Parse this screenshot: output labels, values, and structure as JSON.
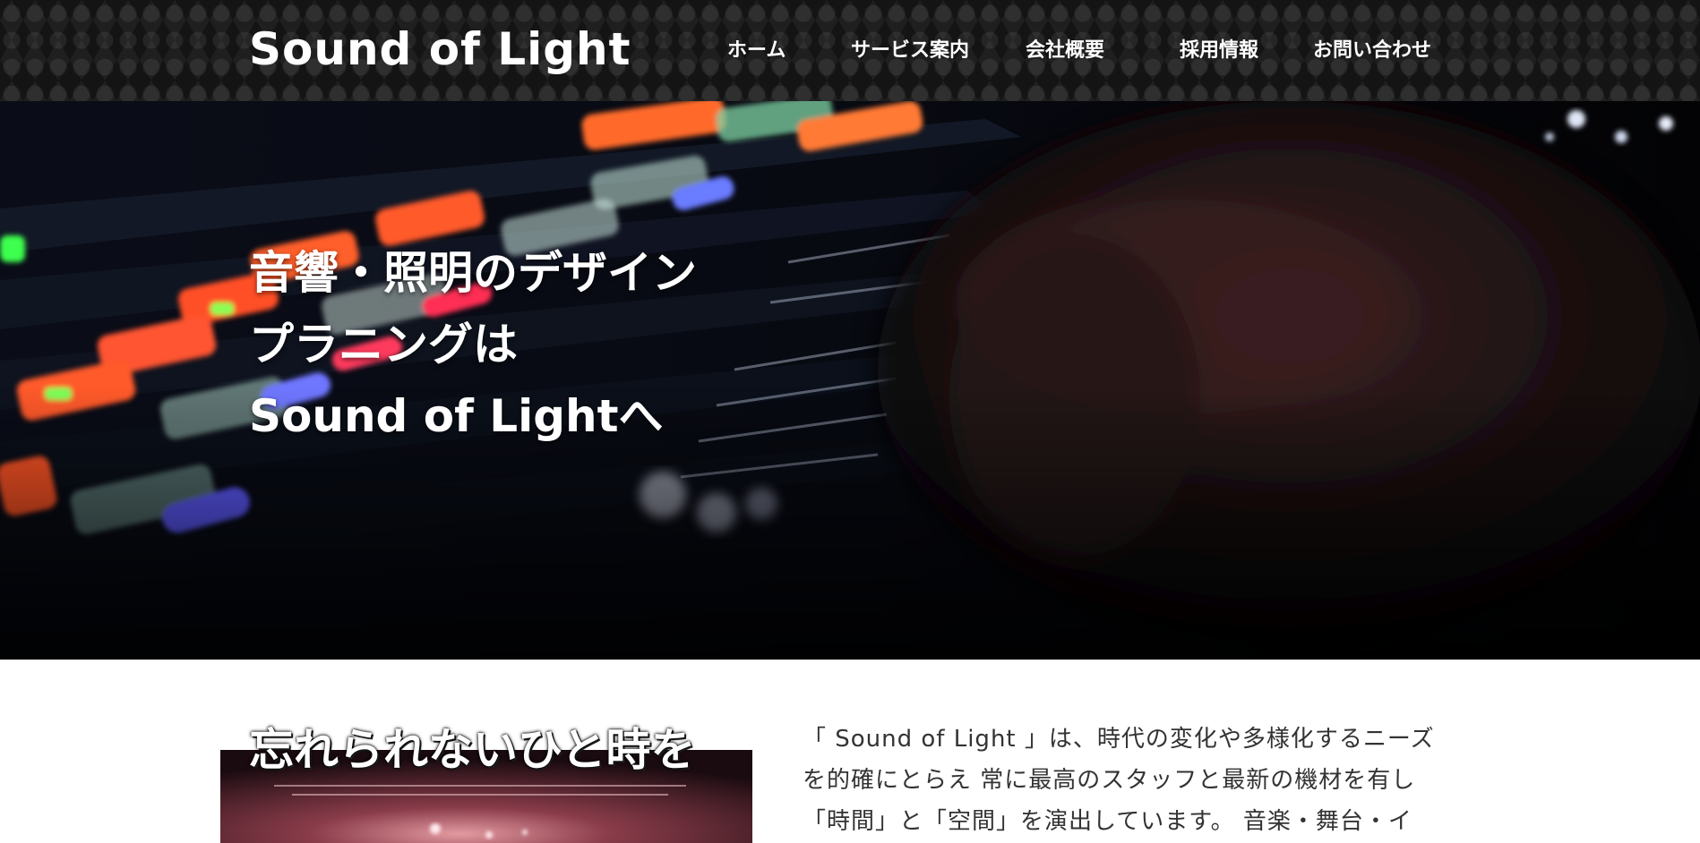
{
  "header": {
    "logo": "Sound of Light",
    "nav": [
      {
        "label": "ホーム"
      },
      {
        "label": "サービス案内"
      },
      {
        "label": "会社概要"
      },
      {
        "label": "採用情報"
      },
      {
        "label": "お問い合わせ"
      }
    ]
  },
  "hero": {
    "lines": [
      "音響・照明のデザイン",
      "プラニングは",
      "Sound of Lightへ"
    ]
  },
  "intro": {
    "heading": "忘れられないひと時を",
    "body_lines": [
      "「 Sound of Light 」は、時代の変化や多様化するニーズ",
      "を的確にとらえ 常に最高のスタッフと最新の機材を有し",
      "「時間」と「空間」を演出しています。 音楽・舞台・イ"
    ]
  },
  "colors": {
    "header_bg": "#1f1f1f",
    "text_dark": "#333333",
    "white": "#ffffff"
  }
}
